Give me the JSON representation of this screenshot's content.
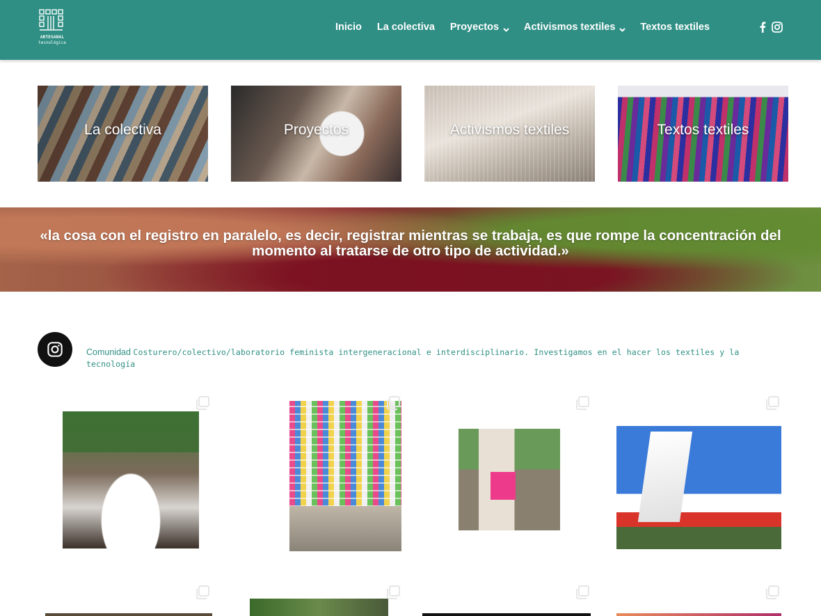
{
  "header": {
    "logo_line1": "ARTESANAL",
    "logo_line2": "tecnológica",
    "nav": [
      {
        "label": "Inicio",
        "has_dropdown": false
      },
      {
        "label": "La colectiva",
        "has_dropdown": false
      },
      {
        "label": "Proyectos",
        "has_dropdown": true
      },
      {
        "label": "Activismos textiles",
        "has_dropdown": true
      },
      {
        "label": "Textos textiles",
        "has_dropdown": false
      }
    ],
    "social_icons": [
      "facebook-icon",
      "instagram-icon"
    ]
  },
  "tiles": [
    {
      "label": "La colectiva"
    },
    {
      "label": "Proyectos"
    },
    {
      "label": "Activismos textiles"
    },
    {
      "label": "Textos textiles"
    }
  ],
  "quote": {
    "text": "«la cosa con el registro en paralelo, es decir, registrar mientras se trabaja, es que rompe la concentración del momento al tratarse de otro tipo de actividad.»"
  },
  "instagram": {
    "bio_prefix": "Comunidad",
    "bio_text": "Costurero/colectivo/laboratorio feminista intergeneracional e interdisciplinario. Investigamos en el hacer los textiles y la tecnología"
  },
  "colors": {
    "brand_teal": "#2f8f84",
    "header_text": "#ffffff"
  }
}
